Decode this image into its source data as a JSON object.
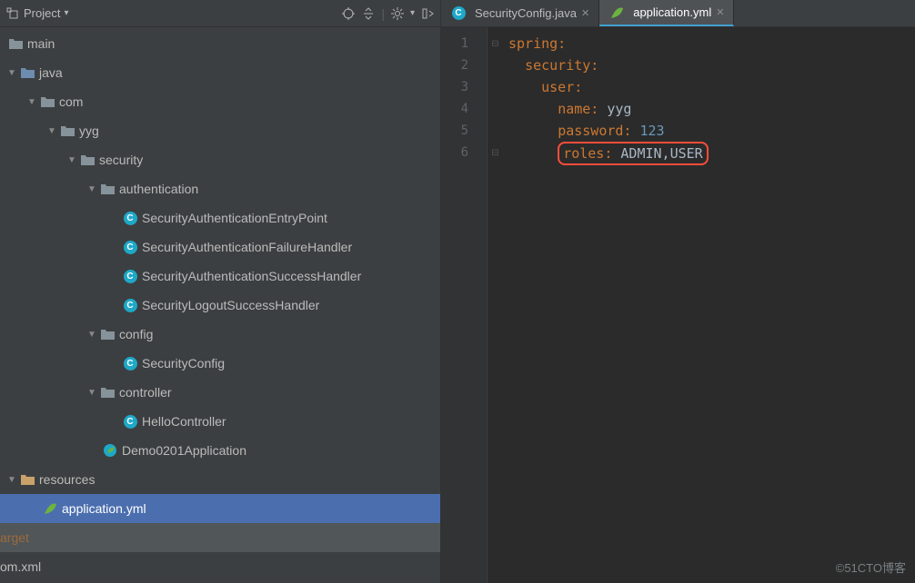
{
  "header": {
    "title": "Project",
    "dropdown_arrow": "▾"
  },
  "tree": {
    "main": "main",
    "java": "java",
    "com": "com",
    "yyg": "yyg",
    "security": "security",
    "authentication": "authentication",
    "files_auth": [
      "SecurityAuthenticationEntryPoint",
      "SecurityAuthenticationFailureHandler",
      "SecurityAuthenticationSuccessHandler",
      "SecurityLogoutSuccessHandler"
    ],
    "config": "config",
    "config_file": "SecurityConfig",
    "controller": "controller",
    "controller_file": "HelloController",
    "app_class": "Demo0201Application",
    "resources": "resources",
    "app_yml": "application.yml",
    "target": "arget",
    "pom": "om.xml"
  },
  "tabs": [
    {
      "label": "SecurityConfig.java",
      "icon": "class"
    },
    {
      "label": "application.yml",
      "icon": "spring",
      "active": true
    }
  ],
  "code": {
    "lines": [
      {
        "indent": 0,
        "key": "spring:",
        "val": ""
      },
      {
        "indent": 1,
        "key": "security:",
        "val": ""
      },
      {
        "indent": 2,
        "key": "user:",
        "val": ""
      },
      {
        "indent": 3,
        "key": "name:",
        "val": " yyg"
      },
      {
        "indent": 3,
        "key": "password:",
        "val": " 123",
        "numeric": true
      },
      {
        "indent": 3,
        "key": "roles:",
        "val": " ADMIN,USER",
        "boxed": true
      }
    ],
    "gutter": [
      "1",
      "2",
      "3",
      "4",
      "5",
      "6"
    ]
  },
  "watermark": "©51CTO博客"
}
